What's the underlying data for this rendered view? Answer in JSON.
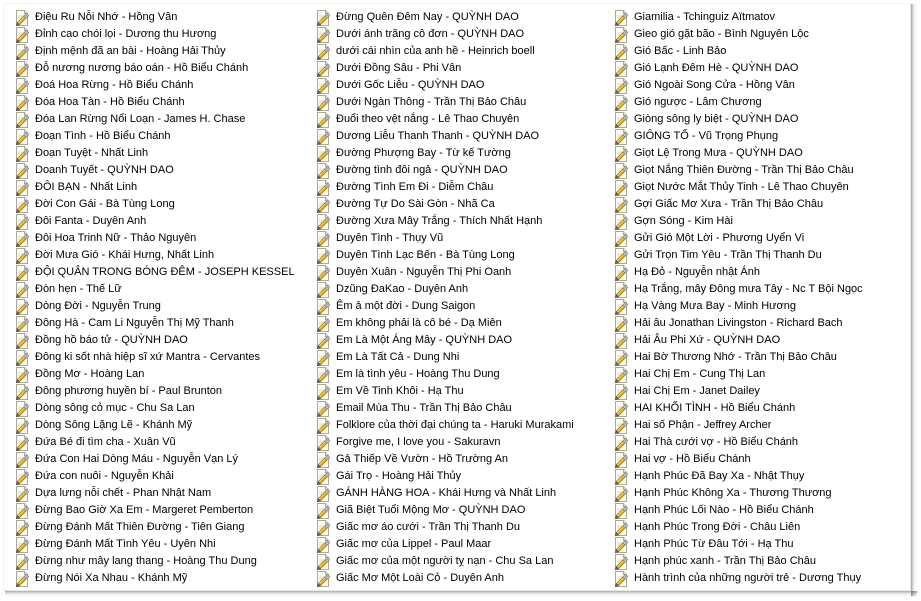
{
  "window": {
    "view_mode": "list",
    "icon_name": "wordpad-document-icon",
    "columns": 3,
    "rows_per_column": 34
  },
  "file_list": {
    "columns": [
      {
        "index": 0,
        "items": [
          "Điệu Ru Nỗi Nhớ - Hồng Vân",
          "Đỉnh cao chói lọi - Dương thu Hương",
          "Định mệnh đã an bài - Hoàng Hải Thủy",
          "Đỗ nương nương báo oán - Hồ Biểu Chánh",
          "Đoá Hoa Rừng - Hồ Biểu Chánh",
          "Đóa Hoa Tàn - Hồ Biểu Chánh",
          "Đóa Lan Rừng Nổi Loạn - James H. Chase",
          "Đoạn Tình - Hồ Biểu Chánh",
          "Đoạn Tuyệt - Nhất Linh",
          "Doanh Tuyết - QUỲNH DAO",
          "ĐÔI BẠN - Nhất Linh",
          "Đời Con Gái - Bà Tùng Long",
          "Đôi Fanta - Duyên Anh",
          "Đôi Hoa Trinh Nữ - Thảo Nguyên",
          "Đời Mưa Gió - Khái Hưng, Nhất Linh",
          "ĐỘI QUÂN TRONG BÓNG ĐÊM - JOSEPH KESSEL",
          "Đòn hẹn - Thế Lữ",
          "Dòng Đời - Nguyễn Trung",
          "Đông Hà - Cam Li Nguyễn Thị Mỹ Thanh",
          "Đồng hồ báo tử - QUỲNH DAO",
          "Đông ki sốt nhà hiệp sĩ xứ Mantra - Cervantes",
          "Đồng Mơ - Hoàng Lan",
          "Đông phương huyền bí - Paul Brunton",
          "Dòng sông cỏ mục - Chu Sa Lan",
          "Dòng Sông Lặng Lẽ - Khánh Mỹ",
          "Đứa Bé đi tìm cha - Xuân Vũ",
          "Đứa Con Hai Dòng Máu - Nguyễn Vạn Lý",
          "Đứa con nuôi - Nguyễn Khải",
          "Dựa lưng nỗi chết - Phan Nhật Nam",
          "Đừng Bao Giờ Xa Em - Margeret Pemberton",
          "Đừng Đánh Mất Thiên Đường - Tiên Giang",
          "Đừng Đánh Mất Tình Yêu - Uyên Nhi",
          "Đừng như mây lang thang - Hoàng Thu Dung",
          "Đừng Nói Xa Nhau - Khánh Mỹ"
        ]
      },
      {
        "index": 1,
        "items": [
          "Đừng Quên Đêm Nay - QUỲNH DAO",
          "Dưới ánh trăng cô đơn - QUỲNH DAO",
          "dưới cái nhìn của anh hề - Heinrich boell",
          "Dưới Đồng Sâu - Phi Vân",
          "Dưới Gốc Liễu - QUỲNH DAO",
          "Dưới Ngàn Thông - Trần Thị Bảo Châu",
          "Đuổi theo vệt nắng - Lê Thao Chuyên",
          "Dương Liễu Thanh Thanh - QUỲNH DAO",
          "Đường Phượng Bay - Từ kế Tường",
          "Đường tình đôi ngả - QUỲNH DAO",
          "Đường Tình Em Đi - Diễm Châu",
          "Đường Tự Do Sài Gòn - Nhã Ca",
          "Đường Xưa Mây Trắng - Thích Nhất Hạnh",
          "Duyên Tình - Thụy Vũ",
          "Duyên Tình Lạc Bến - Bà Tùng Long",
          "Duyên Xuân - Nguyễn Thị Phi Oanh",
          "Dzũng ĐaKao - Duyên Anh",
          "Êm ả một đời - Dung Saigon",
          "Em không phải là cô bé - Dạ Miên",
          "Em Là Một Áng Mây - QUỲNH DAO",
          "Em Là Tất Cả - Dung Nhi",
          "Em là tình yêu - Hoàng Thu Dung",
          "Em Về Tinh Khôi - Hạ Thu",
          "Email Mùa Thu - Trần Thị Bảo Châu",
          "Folklore của thời đại chúng ta - Haruki Murakami",
          "Forgive me, I love you - Sakuravn",
          "Gả Thiếp Về Vườn - Hồ Trường An",
          "Gái Trọ - Hoàng Hải Thủy",
          "GÁNH HÀNG HOA - Khái Hưng và Nhất Linh",
          "Giã Biệt Tuổi Mộng Mơ - QUỲNH DAO",
          "Giấc mơ áo cưới - Trần Thị Thanh Du",
          "Giấc mơ của Lippel - Paul Maar",
          "Giấc mơ của một người tỵ nạn - Chu Sa Lan",
          "Giấc Mơ Một Loài Cỏ - Duyên Anh"
        ]
      },
      {
        "index": 2,
        "items": [
          "Giamilia - Tchinguiz Aïtmatov",
          "Gieo gió gặt bão - Bình Nguyên Lộc",
          "Gió Bấc - Linh Bảo",
          "Gió Lạnh Đêm Hè - QUỲNH DAO",
          "Gió Ngoài Song Cửa - Hồng Vân",
          "Gió ngược - Lâm Chương",
          "Giòng sông ly biệt - QUỲNH DAO",
          "GIÔNG TỐ - Vũ Trọng Phụng",
          "Giọt Lệ Trong Mưa - QUỲNH DAO",
          "Giọt Nắng Thiên Đường - Trần Thị Bảo Châu",
          "Giọt Nước Mắt Thủy Tinh - Lê Thao Chuyên",
          "Gợi Giấc Mơ Xưa - Trần Thị Bảo Châu",
          "Gợn Sóng - Kim Hài",
          "Gửi Gió Một Lời - Phương Uyển Vi",
          "Gửi Trọn Tim Yêu - Trần Thị Thanh Du",
          "Hạ Đỏ - Nguyễn nhật Ánh",
          "Hạ Trắng, mây Đông mưa Tây - Nc T Bội Ngọc",
          "Hạ Vàng Mưa Bay - Minh Hương",
          "Hải âu Jonathan Livingston - Richard Bach",
          "Hải Âu Phi Xứ - QUỲNH DAO",
          "Hai Bờ Thương Nhớ - Trần Thị Bảo Châu",
          "Hai Chị Em - Cung Thị Lan",
          "Hai Chị Em - Janet Dailey",
          "HAI KHỐI TÌNH - Hồ Biểu Chánh",
          "Hai số Phận - Jeffrey Archer",
          "Hai Thà cưới vợ - Hồ Biểu Chánh",
          "Hai vợ - Hồ Biểu Chánh",
          "Hạnh Phúc Đã Bay Xa - Nhật Thụy",
          "Hạnh Phúc Không Xa - Thương Thương",
          "Hạnh Phúc Lối Nào - Hồ Biểu Chánh",
          "Hạnh Phúc Trong Đời - Châu Liên",
          "Hạnh Phúc Từ Đâu Tới - Hạ Thu",
          "Hạnh phúc xanh - Trần Thị Bảo Châu",
          "Hành trình của những người trẻ - Dương Thụy"
        ]
      }
    ]
  },
  "colors": {
    "background": "#ffffff",
    "text": "#000000",
    "icon_page": "#fdfdf5",
    "icon_pencil_light": "#f5d96b",
    "icon_pencil_dark": "#c98a17",
    "icon_border": "#b9b9a8",
    "frame_border": "#e8e8e8"
  }
}
